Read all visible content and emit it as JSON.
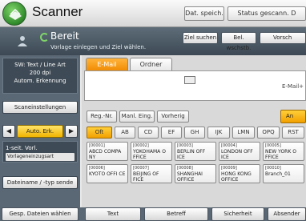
{
  "header": {
    "title": "Scanner",
    "buttons": [
      {
        "label": "Dat. speich."
      },
      {
        "label": "Status gescann. D"
      }
    ]
  },
  "status": {
    "ready": "Bereit",
    "subtitle": "Vorlage einlegen und Ziel wählen.",
    "buttons": [
      {
        "label": "Ziel suchen"
      },
      {
        "label": "Bel. wschstb."
      },
      {
        "label": "Vorsch"
      }
    ]
  },
  "left_panel": {
    "info_line1": "SW: Text / Line Art",
    "info_line2": "200 dpi",
    "info_line3": "Autom. Erkennung",
    "scan_settings": "Scaneinstellungen",
    "zoom_left": "◀",
    "zoom_value": "Auto. Erk.",
    "zoom_right": "▶",
    "sided_line1": "1-seit. Vorl.",
    "sided_line2": "Vorlageneinzugsart",
    "file_type": "Dateiname / -typ sende"
  },
  "tabs": [
    {
      "label": "E-Mail"
    },
    {
      "label": "Ordner"
    }
  ],
  "destination": {
    "label": "E-Mail+"
  },
  "small_buttons": [
    {
      "label": "Reg.-Nr."
    },
    {
      "label": "Manl. Eing."
    },
    {
      "label": "Vorherig"
    }
  ],
  "an_button": "An",
  "index_tabs": [
    "Oft",
    "AB",
    "CD",
    "EF",
    "GH",
    "IJK",
    "LMN",
    "OPQ",
    "RST"
  ],
  "destinations": [
    {
      "num": "[00001]",
      "name": "ABCD COMPA NY"
    },
    {
      "num": "[00002]",
      "name": "YOKOHAMA O FFICE"
    },
    {
      "num": "[00003]",
      "name": "BERLIN OFF ICE"
    },
    {
      "num": "[00004]",
      "name": "LONDON OFF ICE"
    },
    {
      "num": "[00005]",
      "name": "NEW YORK O FFICE"
    },
    {
      "num": "[00006]",
      "name": "KYOTO OFFI CE"
    },
    {
      "num": "[00007]",
      "name": "BEIJING OF FICE"
    },
    {
      "num": "[00008]",
      "name": "SHANGHAI OFFICE"
    },
    {
      "num": "[00009]",
      "name": "HONG KONG OFFICE"
    },
    {
      "num": "[00010]",
      "name": "Branch_01"
    }
  ],
  "bottom": {
    "button1": "Gesp. Dateien wählen",
    "button2": "Text",
    "button3": "Betreff",
    "button4": "Sicherheit",
    "button5": "Absender"
  }
}
